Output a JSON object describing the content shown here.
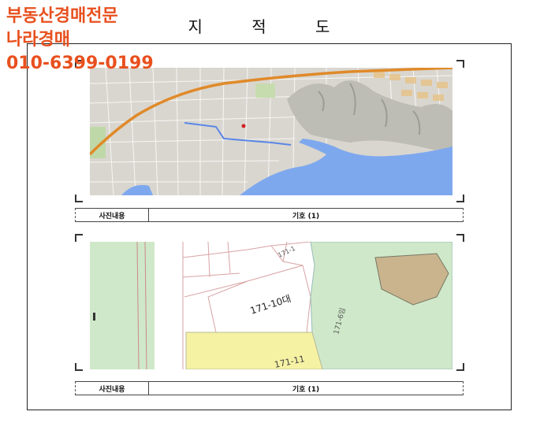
{
  "watermark": {
    "line1": "부동산경매전문",
    "line2": "나라경매",
    "phone": "010-6399-0199"
  },
  "document": {
    "title": "지 적 도"
  },
  "photos": [
    {
      "caption_label": "사진내용",
      "caption_value": "기호 (1)"
    },
    {
      "caption_label": "사진내용",
      "caption_value": "기호 (1)"
    }
  ],
  "cadastral_map": {
    "parcel_labels": [
      "171-10대",
      "171-1",
      "171-6임",
      "171-11"
    ]
  },
  "colors": {
    "watermark": "#e8501e",
    "sea": "#7ea8ee",
    "forest": "#cfe8c9",
    "yellow_parcel": "#f6f2a3",
    "brown_parcel": "#c9b48e"
  }
}
